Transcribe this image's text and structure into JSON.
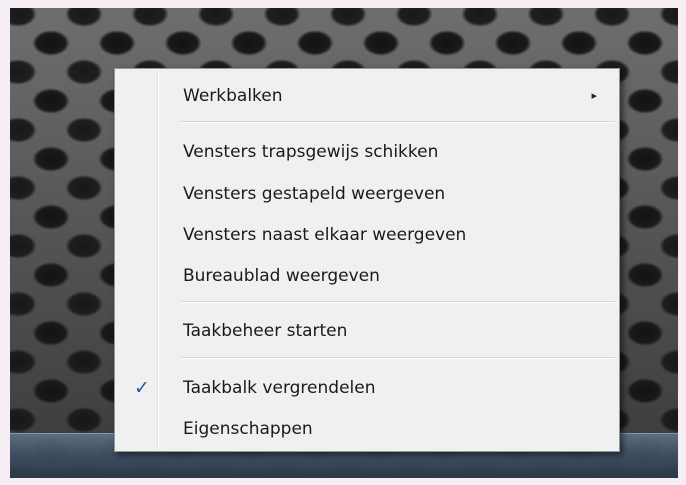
{
  "context_menu": {
    "items": [
      {
        "label": "Werkbalken",
        "submenu_arrow": "▸"
      },
      {
        "label": "Vensters trapsgewijs schikken"
      },
      {
        "label": "Vensters gestapeld weergeven"
      },
      {
        "label": "Vensters naast elkaar weergeven"
      },
      {
        "label": "Bureaublad weergeven"
      },
      {
        "label": "Taakbeheer starten"
      },
      {
        "label": "Taakbalk vergrendelen",
        "checked": true,
        "check_glyph": "✓"
      },
      {
        "label": "Eigenschappen"
      }
    ]
  },
  "icons": {
    "submenu": "chevron-right-icon",
    "check": "checkmark-icon"
  },
  "colors": {
    "menu_background": "#f0f0f0",
    "checkmark": "#2b56a8",
    "taskbar": "#3f5266"
  }
}
